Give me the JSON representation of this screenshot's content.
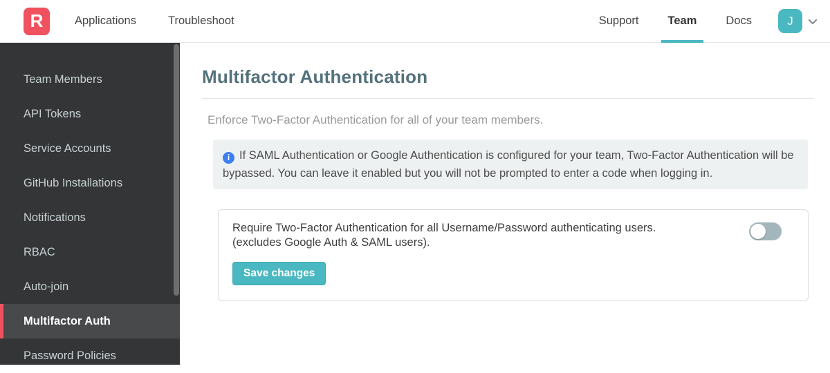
{
  "colors": {
    "brand_red": "#f0515f",
    "teal": "#49b8c1",
    "teal_dark": "#3da7b1",
    "title": "#54717d",
    "sidebar_bg": "#333537",
    "sidebar_active_bg": "#48494b",
    "sidebar_text": "#c9d1d3",
    "info_bg": "#eef1f1",
    "info_icon_blue": "#3d7ff0",
    "text_dark": "#3e3e3e",
    "text_gray": "#9a9a9a",
    "border_light": "#e3e3e3",
    "toggle_off": "#a3b6bb"
  },
  "icons": {
    "info_glyph": "i",
    "chevron_down": "v"
  },
  "navbar": {
    "logo_letter": "R",
    "left_links": [
      {
        "label": "Applications"
      },
      {
        "label": "Troubleshoot"
      }
    ],
    "right_links": [
      {
        "label": "Support",
        "active": false
      },
      {
        "label": "Team",
        "active": true
      },
      {
        "label": "Docs",
        "active": false
      }
    ],
    "avatar_initial": "J"
  },
  "sidebar": {
    "items": [
      {
        "label": "Team Members",
        "active": false
      },
      {
        "label": "API Tokens",
        "active": false
      },
      {
        "label": "Service Accounts",
        "active": false
      },
      {
        "label": "GitHub Installations",
        "active": false
      },
      {
        "label": "Notifications",
        "active": false
      },
      {
        "label": "RBAC",
        "active": false
      },
      {
        "label": "Auto-join",
        "active": false
      },
      {
        "label": "Multifactor Auth",
        "active": true
      },
      {
        "label": "Password Policies",
        "active": false
      }
    ]
  },
  "main": {
    "title": "Multifactor Authentication",
    "description": "Enforce Two-Factor Authentication for all of your team members.",
    "info_note": "If SAML Authentication or Google Authentication is configured for your team, Two-Factor Authentication will be bypassed. You can leave it enabled but you will not be prompted to enter a code when logging in.",
    "setting": {
      "label_line1": "Require Two-Factor Authentication for all Username/Password authenticating users.",
      "label_line2": "(excludes Google Auth & SAML users).",
      "toggle_state": "off",
      "save_button_label": "Save changes"
    }
  }
}
